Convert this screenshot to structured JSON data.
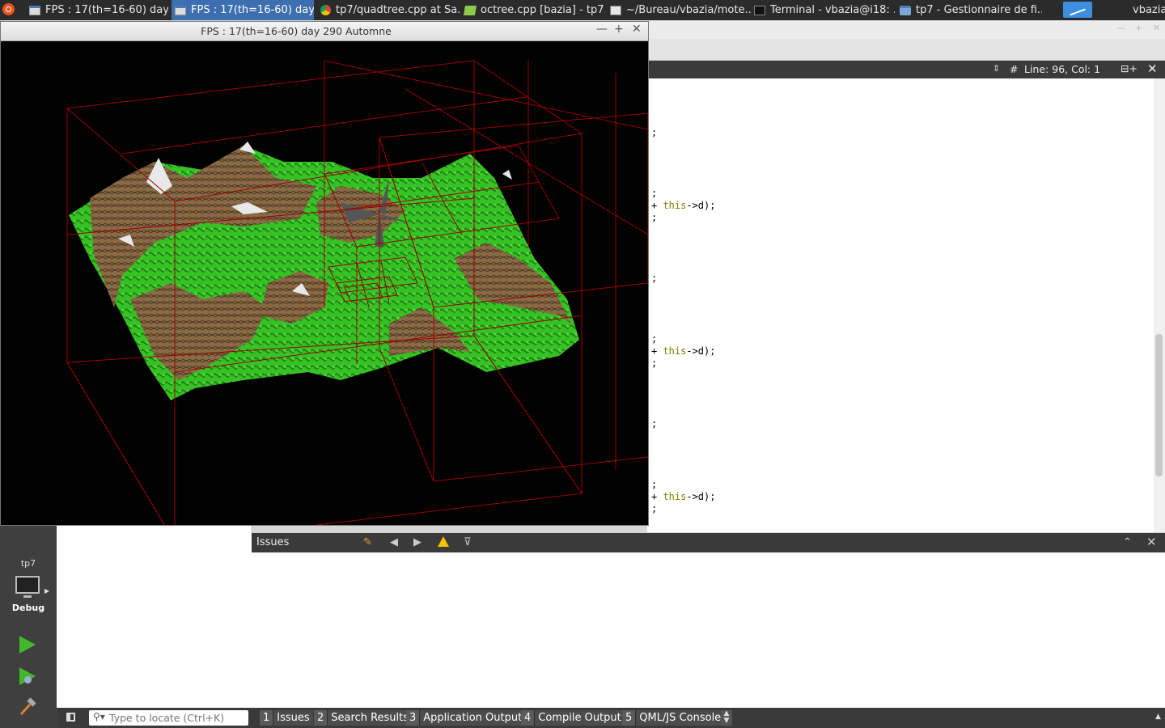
{
  "taskbar": {
    "tasks": [
      {
        "label": "FPS : 17(th=16-60) day ...",
        "icon": "window-icon"
      },
      {
        "label": "FPS : 17(th=16-60) day ...",
        "icon": "window-icon"
      },
      {
        "label": "tp7/quadtree.cpp at Sa...",
        "icon": "chrome-icon"
      },
      {
        "label": "octree.cpp [bazia] - tp7...",
        "icon": "qtcreator-icon"
      },
      {
        "label": "~/Bureau/vbazia/mote...",
        "icon": "text-editor-icon"
      },
      {
        "label": "Terminal - vbazia@i18: ...",
        "icon": "terminal-icon"
      },
      {
        "label": "tp7 - Gestionnaire de fi...",
        "icon": "folder-icon"
      }
    ],
    "user": "vbazia"
  },
  "fps_window": {
    "title": "FPS : 17(th=16-60) day 290 Automne"
  },
  "editor": {
    "cursor_position": "Line: 96, Col: 1",
    "hash": "#",
    "code_lines": [
      {
        "pre": ";",
        "kw": "",
        "post": ""
      },
      {
        "pre": ";",
        "kw": "",
        "post": ""
      },
      {
        "pre": "+ ",
        "kw": "this",
        "post": "->d);"
      },
      {
        "pre": ";",
        "kw": "",
        "post": ""
      },
      {
        "pre": ";",
        "kw": "",
        "post": ""
      },
      {
        "pre": ";",
        "kw": "",
        "post": ""
      },
      {
        "pre": "+ ",
        "kw": "this",
        "post": "->d);"
      },
      {
        "pre": ";",
        "kw": "",
        "post": ""
      },
      {
        "pre": ";",
        "kw": "",
        "post": ""
      },
      {
        "pre": ";",
        "kw": "",
        "post": ""
      },
      {
        "pre": "+ ",
        "kw": "this",
        "post": "->d);"
      },
      {
        "pre": ";",
        "kw": "",
        "post": ""
      }
    ]
  },
  "modebar": {
    "project": "tp7",
    "build_config": "Debug"
  },
  "issues": {
    "title": "Issues"
  },
  "statusbar": {
    "locator_placeholder": "Type to locate (Ctrl+K)",
    "output_tabs": [
      {
        "num": "1",
        "label": "Issues"
      },
      {
        "num": "2",
        "label": "Search Results"
      },
      {
        "num": "3",
        "label": "Application Output"
      },
      {
        "num": "4",
        "label": "Compile Output"
      },
      {
        "num": "5",
        "label": "QML/JS Console"
      }
    ]
  },
  "colors": {
    "taskbar_bg": "#2b2b2b",
    "active_task": "#3d6fb0",
    "octree_lines": "#8b0000",
    "grass": "#3fd12a",
    "rock": "#8a6a45",
    "snow": "#e8e8e8",
    "run_green": "#42b72a",
    "keyword": "#808000"
  }
}
